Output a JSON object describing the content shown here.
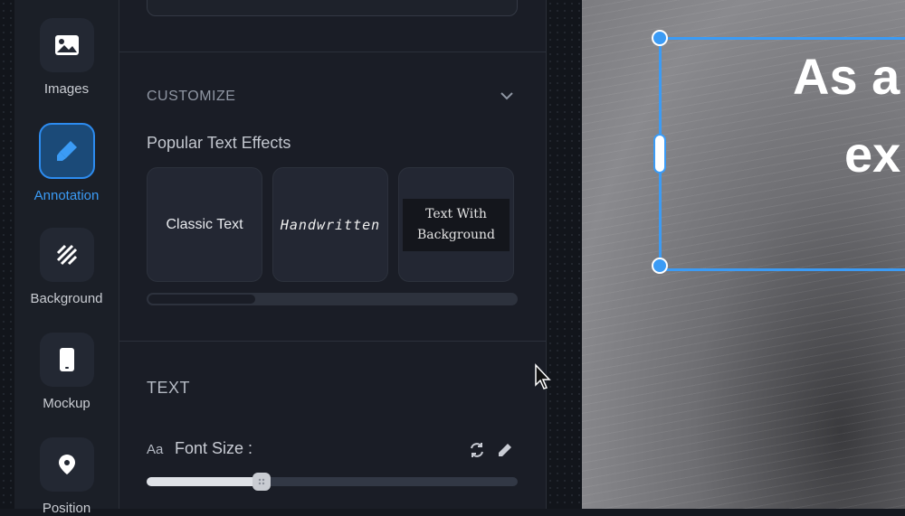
{
  "sidebar": {
    "items": [
      {
        "label": "Images",
        "icon": "image-icon",
        "active": false
      },
      {
        "label": "Annotation",
        "icon": "highlighter-icon",
        "active": true
      },
      {
        "label": "Background",
        "icon": "stripes-icon",
        "active": false
      },
      {
        "label": "Mockup",
        "icon": "phone-icon",
        "active": false
      },
      {
        "label": "Position",
        "icon": "location-pin-icon",
        "active": false
      }
    ]
  },
  "panel": {
    "customize_title": "CUSTOMIZE",
    "effects_heading": "Popular Text Effects",
    "effects": [
      {
        "label": "Classic Text"
      },
      {
        "label": "Handwritten"
      },
      {
        "label": "Text With Background"
      }
    ],
    "text_title": "TEXT",
    "font_size": {
      "aa_glyph": "Aa",
      "label": "Font Size :",
      "slider_fraction": 0.31
    }
  },
  "canvas": {
    "line1": "As a",
    "line2": "ex"
  },
  "colors": {
    "accent": "#3b9bf5",
    "panel_bg": "#1a1d26",
    "sidebar_bg": "#1b1f27"
  }
}
